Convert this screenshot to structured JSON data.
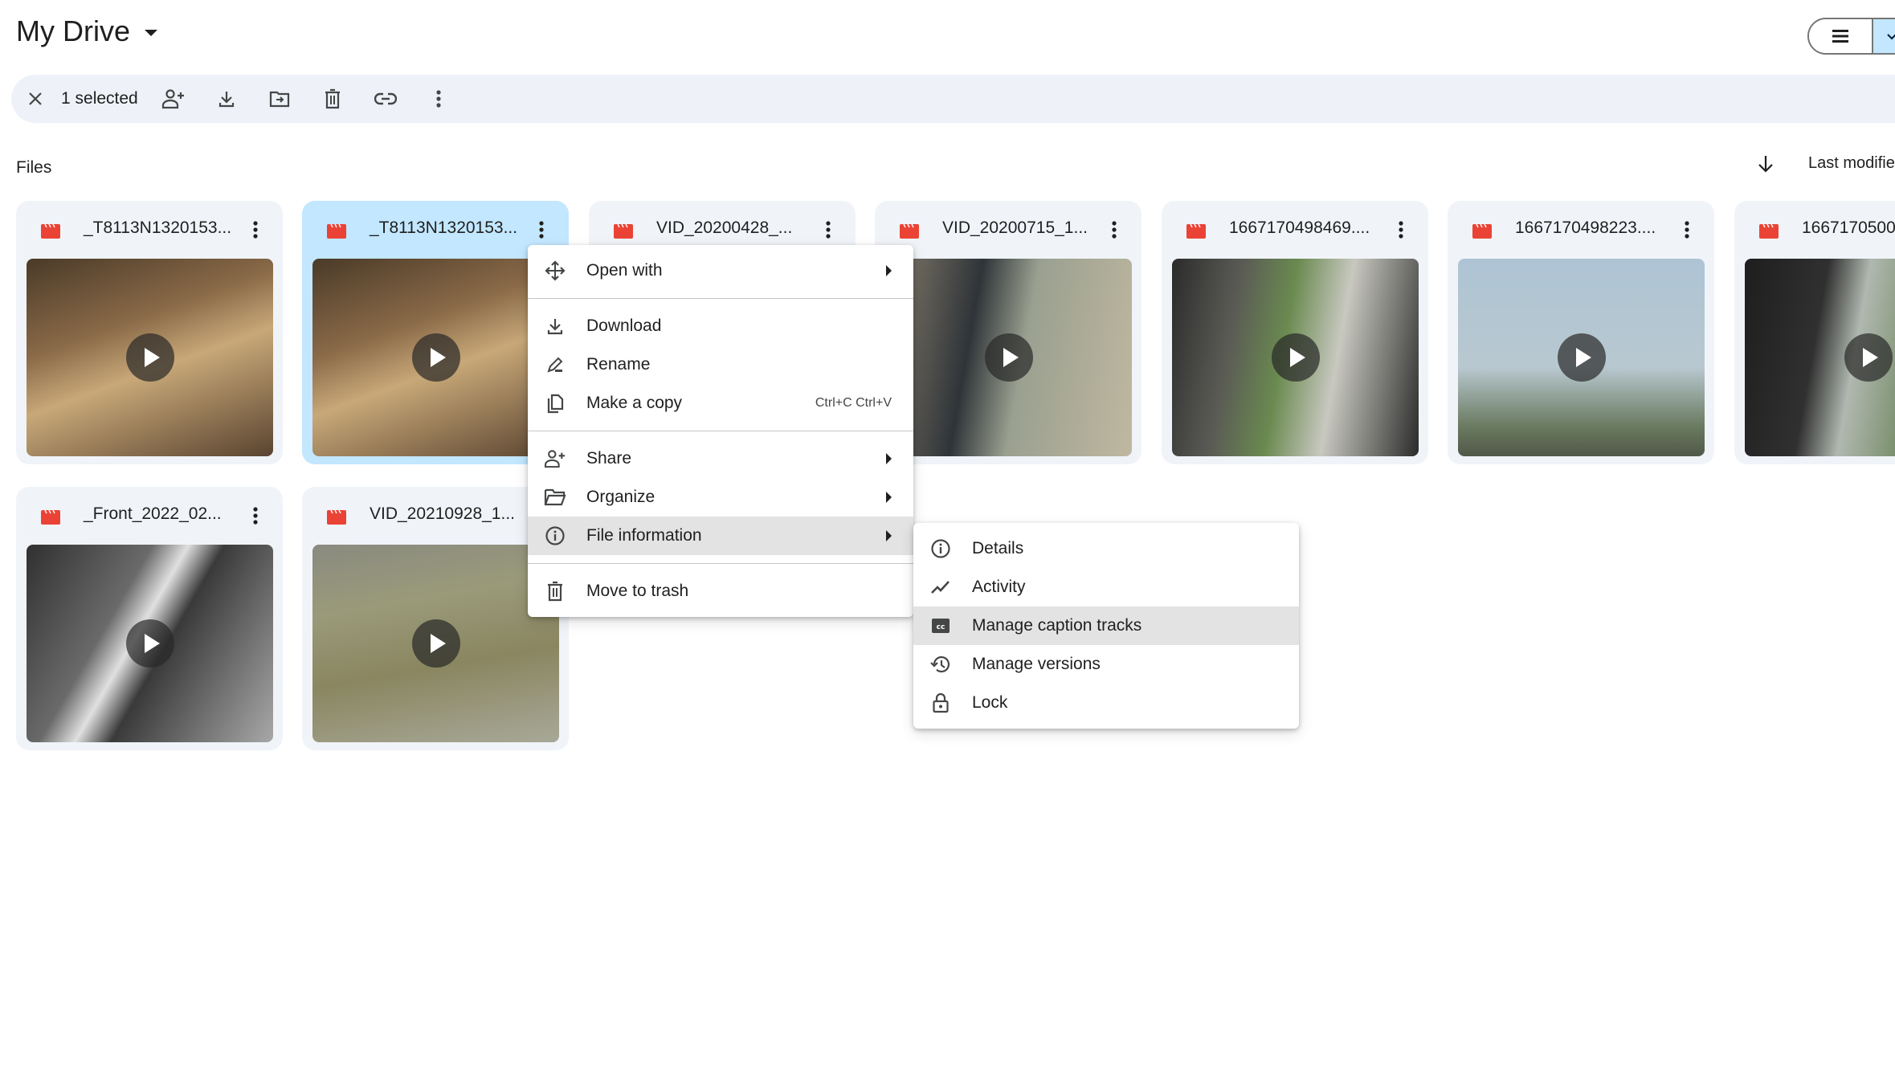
{
  "header": {
    "title": "My Drive",
    "view_toggle": {
      "list_icon": "list-icon",
      "grid_icon": "chevron-down-icon"
    }
  },
  "toolbar": {
    "close_icon": "close-icon",
    "selected_count": "1 selected",
    "actions": [
      {
        "name": "share",
        "icon": "person-add-icon"
      },
      {
        "name": "download",
        "icon": "download-icon"
      },
      {
        "name": "move",
        "icon": "folder-move-icon"
      },
      {
        "name": "trash",
        "icon": "trash-icon"
      },
      {
        "name": "copy-link",
        "icon": "link-icon"
      },
      {
        "name": "more",
        "icon": "more-vert-icon"
      }
    ]
  },
  "section": {
    "label": "Files",
    "sort_direction_icon": "arrow-down-icon",
    "sort_label": "Last modified"
  },
  "colors": {
    "selected_card": "#c2e7ff",
    "card_bg": "#f0f4f9",
    "video_icon": "#ea4335",
    "toolbar_bg": "#eef2f8",
    "menu_highlight": "#e3e3e3"
  },
  "files": [
    {
      "name": "_T8113N1320153...",
      "type": "video",
      "selected": false
    },
    {
      "name": "_T8113N1320153...",
      "type": "video",
      "selected": true
    },
    {
      "name": "VID_20200428_...",
      "type": "video",
      "selected": false
    },
    {
      "name": "VID_20200715_1...",
      "type": "video",
      "selected": false
    },
    {
      "name": "1667170498469....",
      "type": "video",
      "selected": false
    },
    {
      "name": "1667170498223....",
      "type": "video",
      "selected": false
    },
    {
      "name": "1667170500",
      "type": "video",
      "selected": false
    },
    {
      "name": "_Front_2022_02...",
      "type": "video",
      "selected": false
    },
    {
      "name": "VID_20210928_1...",
      "type": "video",
      "selected": false
    }
  ],
  "context_menu": {
    "items": [
      {
        "label": "Open with",
        "icon": "open-with-icon",
        "submenu": true
      },
      {
        "label": "Download",
        "icon": "download-icon"
      },
      {
        "label": "Rename",
        "icon": "rename-icon"
      },
      {
        "label": "Make a copy",
        "icon": "copy-icon",
        "shortcut": "Ctrl+C Ctrl+V"
      },
      {
        "label": "Share",
        "icon": "person-add-icon",
        "submenu": true
      },
      {
        "label": "Organize",
        "icon": "folder-open-icon",
        "submenu": true
      },
      {
        "label": "File information",
        "icon": "info-icon",
        "submenu": true,
        "highlighted": true
      },
      {
        "label": "Move to trash",
        "icon": "trash-icon"
      }
    ]
  },
  "submenu": {
    "items": [
      {
        "label": "Details",
        "icon": "info-icon"
      },
      {
        "label": "Activity",
        "icon": "activity-icon"
      },
      {
        "label": "Manage caption tracks",
        "icon": "closed-caption-icon",
        "highlighted": true
      },
      {
        "label": "Manage versions",
        "icon": "history-icon"
      },
      {
        "label": "Lock",
        "icon": "lock-icon"
      }
    ]
  }
}
